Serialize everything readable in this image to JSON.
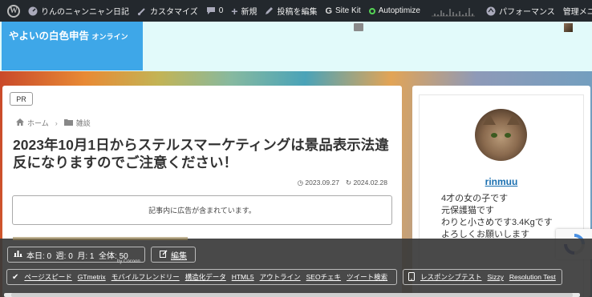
{
  "admin_bar": {
    "wp_logo": "W",
    "site_name": "りんのニャンニャン日記",
    "customize": "カスタマイズ",
    "comments_count": "0",
    "new": "新規",
    "edit_post": "投稿を編集",
    "site_kit": "Site Kit",
    "autoptimize": "Autoptimize",
    "performance": "パフォーマンス",
    "admin_menu": "管理メニュー"
  },
  "site": {
    "logo_main": "やよいの白色申告",
    "logo_sub": "オンライン"
  },
  "post": {
    "pr_label": "PR",
    "breadcrumb_home": "ホーム",
    "breadcrumb_category": "雑談",
    "title": "2023年10月1日からステルスマーケティングは景品表示法違反になりますのでご注意ください！",
    "published": "2023.09.27",
    "updated": "2024.02.28",
    "ad_notice": "記事内に広告が含まれています。"
  },
  "author": {
    "name": "rinmuu",
    "bio": [
      "4才の女の子です",
      "元保護猫です",
      "わりと小さめです3.4Kgです",
      "よろしくお願いします"
    ]
  },
  "toolbar": {
    "counts": "本日: 0  週: 0  月: 1  全体: 50",
    "by": "by Cocoon",
    "edit": "編集",
    "tools": [
      "ページスピード",
      "GTmetrix",
      "モバイルフレンドリー",
      "構造化データ",
      "HTML5",
      "アウトライン",
      "SEOチェキ",
      "ツイート検索"
    ],
    "responsive": [
      "レスポンシブテスト",
      "Sizzy",
      "Resolution Test"
    ]
  },
  "colors": {
    "admin_bar": "#23282d",
    "logo_bg": "#3ea7e8",
    "header_band": "#e2fafa",
    "author_link": "#1a6fb0",
    "overlay": "#3a3a3a"
  }
}
